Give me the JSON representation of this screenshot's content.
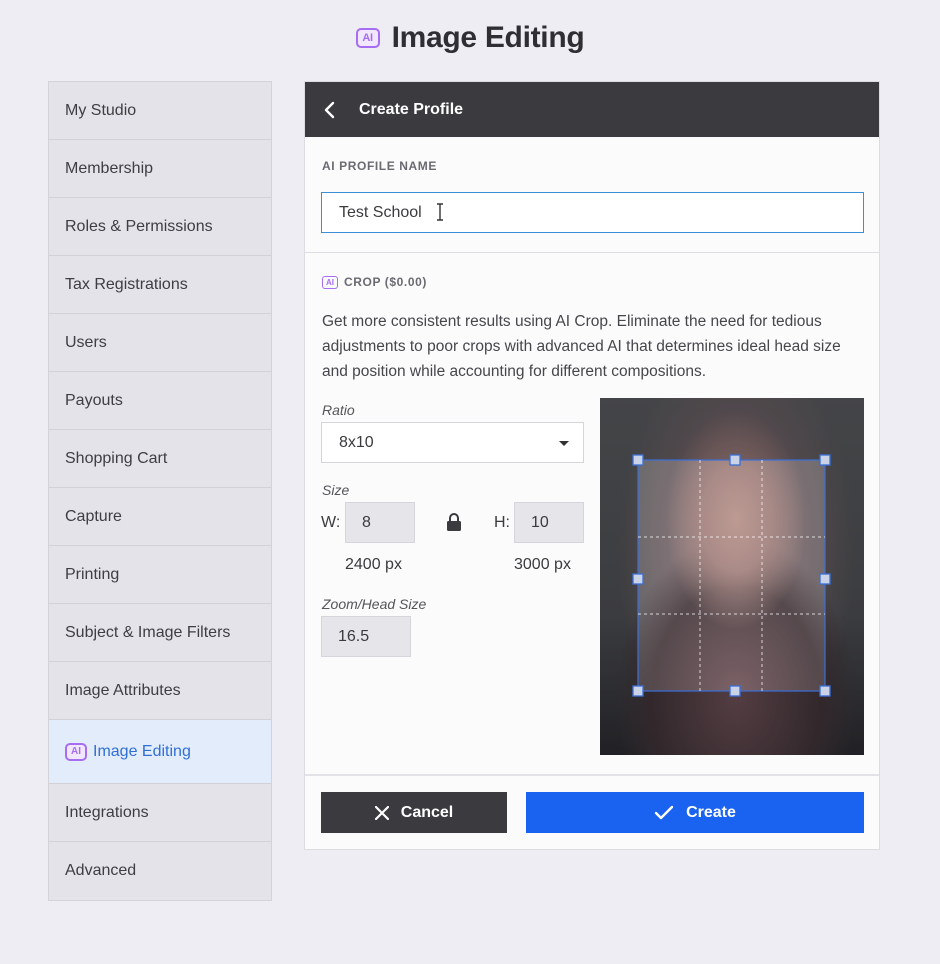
{
  "page": {
    "title": "Image Editing",
    "title_badge": "AI"
  },
  "sidebar": {
    "items": [
      {
        "label": "My Studio"
      },
      {
        "label": "Membership"
      },
      {
        "label": "Roles & Permissions"
      },
      {
        "label": "Tax Registrations"
      },
      {
        "label": "Users"
      },
      {
        "label": "Payouts"
      },
      {
        "label": "Shopping Cart"
      },
      {
        "label": "Capture"
      },
      {
        "label": "Printing"
      },
      {
        "label": "Subject & Image Filters"
      },
      {
        "label": "Image Attributes"
      },
      {
        "label": "Image Editing",
        "badge": "AI",
        "active": true
      },
      {
        "label": "Integrations"
      },
      {
        "label": "Advanced"
      }
    ]
  },
  "panel": {
    "header_title": "Create Profile",
    "profile_name_label": "AI PROFILE NAME",
    "profile_name_value": "Test School",
    "crop_badge": "AI",
    "crop_label": "CROP ($0.00)",
    "crop_description": "Get more consistent results using AI Crop. Eliminate the need for tedious adjustments to poor crops with advanced AI that determines ideal head size and position while accounting for different compositions.",
    "ratio_label": "Ratio",
    "ratio_value": "8x10",
    "size_label": "Size",
    "width_label": "W:",
    "width_value": "8",
    "height_label": "H:",
    "height_value": "10",
    "width_px": "2400 px",
    "height_px": "3000 px",
    "zoom_label": "Zoom/Head Size",
    "zoom_value": "16.5",
    "cancel_label": "Cancel",
    "create_label": "Create"
  },
  "colors": {
    "accent": "#1a63f0",
    "header_bg": "#3b3a3f",
    "ai_purple": "#a66df0",
    "active_text": "#2f6fd6"
  }
}
